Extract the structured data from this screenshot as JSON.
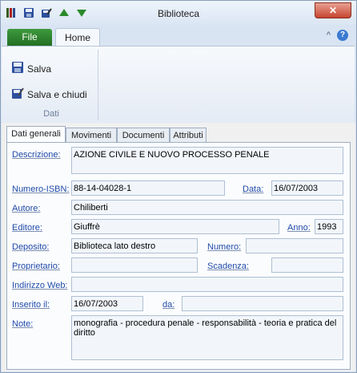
{
  "window": {
    "title": "Biblioteca",
    "close": "✕"
  },
  "ribbon": {
    "tabs": {
      "file": "File",
      "home": "Home"
    },
    "controls": {
      "minimize": "^"
    },
    "help": "?",
    "buttons": {
      "save": "Salva",
      "save_close": "Salva e chiudi"
    },
    "group_label": "Dati"
  },
  "form_tabs": [
    "Dati generali",
    "Movimenti",
    "Documenti",
    "Attributi"
  ],
  "fields": {
    "descrizione": {
      "label": "Descrizione:",
      "value": "AZIONE CIVILE E NUOVO PROCESSO PENALE"
    },
    "isbn": {
      "label": "Numero-ISBN:",
      "value": "88-14-04028-1"
    },
    "data": {
      "label": "Data:",
      "value": "16/07/2003"
    },
    "autore": {
      "label": "Autore:",
      "value": "Chiliberti"
    },
    "editore": {
      "label": "Editore:",
      "value": "Giuffrè"
    },
    "anno": {
      "label": "Anno:",
      "value": "1993"
    },
    "deposito": {
      "label": "Deposito:",
      "value": "Biblioteca lato destro"
    },
    "numero": {
      "label": "Numero:",
      "value": ""
    },
    "proprietario": {
      "label": "Proprietario:",
      "value": ""
    },
    "scadenza": {
      "label": "Scadenza:",
      "value": ""
    },
    "web": {
      "label": "Indirizzo Web:",
      "value": ""
    },
    "inserito": {
      "label": "Inserito il:",
      "value": "16/07/2003"
    },
    "da": {
      "label": "da:",
      "value": ""
    },
    "note": {
      "label": "Note:",
      "value": "monografia - procedura penale - responsabilità - teoria e pratica del diritto"
    }
  },
  "colors": {
    "accent_file": "#2e8b2e",
    "label_blue": "#1f4aa8",
    "close_red": "#c6452f"
  }
}
